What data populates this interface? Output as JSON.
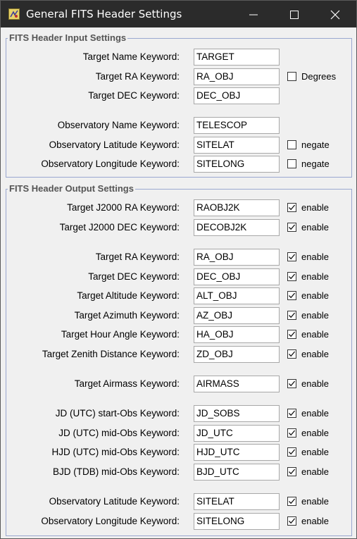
{
  "window": {
    "title": "General FITS Header Settings"
  },
  "input_group": {
    "title": "FITS Header Input Settings",
    "rows": [
      {
        "label": "Target Name Keyword:",
        "value": "TARGET"
      },
      {
        "label": "Target RA Keyword:",
        "value": "RA_OBJ",
        "check_label": "Degrees",
        "checked": false
      },
      {
        "label": "Target DEC Keyword:",
        "value": "DEC_OBJ"
      },
      {
        "label": "Observatory Name Keyword:",
        "value": "TELESCOP"
      },
      {
        "label": "Observatory Latitude Keyword:",
        "value": "SITELAT",
        "check_label": "negate",
        "checked": false
      },
      {
        "label": "Observatory Longitude Keyword:",
        "value": "SITELONG",
        "check_label": "negate",
        "checked": false
      }
    ]
  },
  "output_group": {
    "title": "FITS Header Output Settings",
    "rows": [
      {
        "label": "Target J2000 RA Keyword:",
        "value": "RAOBJ2K",
        "check_label": "enable",
        "checked": true
      },
      {
        "label": "Target J2000 DEC Keyword:",
        "value": "DECOBJ2K",
        "check_label": "enable",
        "checked": true
      },
      {
        "label": "Target RA Keyword:",
        "value": "RA_OBJ",
        "check_label": "enable",
        "checked": true
      },
      {
        "label": "Target DEC Keyword:",
        "value": "DEC_OBJ",
        "check_label": "enable",
        "checked": true
      },
      {
        "label": "Target Altitude Keyword:",
        "value": "ALT_OBJ",
        "check_label": "enable",
        "checked": true
      },
      {
        "label": "Target Azimuth Keyword:",
        "value": "AZ_OBJ",
        "check_label": "enable",
        "checked": true
      },
      {
        "label": "Target Hour Angle Keyword:",
        "value": "HA_OBJ",
        "check_label": "enable",
        "checked": true
      },
      {
        "label": "Target Zenith Distance Keyword:",
        "value": "ZD_OBJ",
        "check_label": "enable",
        "checked": true
      },
      {
        "label": "Target Airmass Keyword:",
        "value": "AIRMASS",
        "check_label": "enable",
        "checked": true
      },
      {
        "label": "JD (UTC) start-Obs Keyword:",
        "value": "JD_SOBS",
        "check_label": "enable",
        "checked": true
      },
      {
        "label": "JD (UTC) mid-Obs Keyword:",
        "value": "JD_UTC",
        "check_label": "enable",
        "checked": true
      },
      {
        "label": "HJD (UTC) mid-Obs Keyword:",
        "value": "HJD_UTC",
        "check_label": "enable",
        "checked": true
      },
      {
        "label": "BJD (TDB) mid-Obs Keyword:",
        "value": "BJD_UTC",
        "check_label": "enable",
        "checked": true
      },
      {
        "label": "Observatory Latitude Keyword:",
        "value": "SITELAT",
        "check_label": "enable",
        "checked": true
      },
      {
        "label": "Observatory Longitude Keyword:",
        "value": "SITELONG",
        "check_label": "enable",
        "checked": true
      }
    ]
  }
}
